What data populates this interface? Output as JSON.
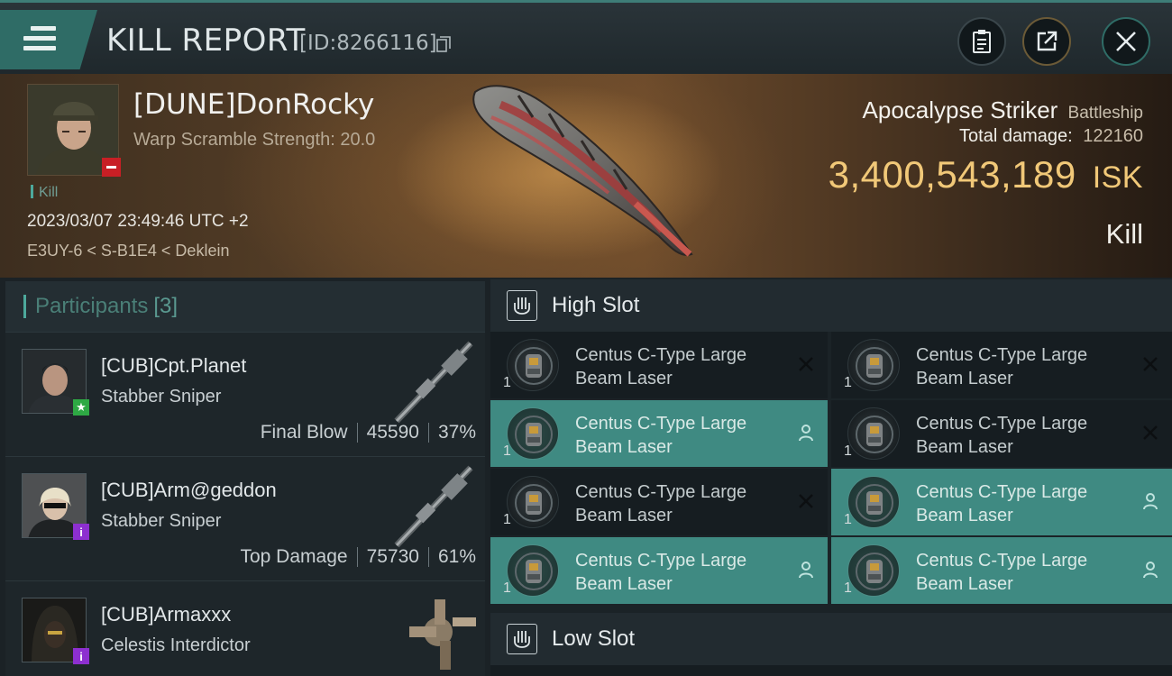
{
  "header": {
    "title": "KILL REPORT",
    "id_text": "[ID:8266116]"
  },
  "victim": {
    "name": "[DUNE]DonRocky",
    "warp_scramble": "Warp Scramble Strength: 20.0",
    "kill_tag": "Kill",
    "timestamp": "2023/03/07 23:49:46 UTC +2",
    "location": "E3UY-6 < S-B1E4 < Deklein"
  },
  "ship": {
    "name": "Apocalypse Striker",
    "class": "Battleship",
    "total_damage_label": "Total damage:",
    "total_damage_value": "122160",
    "isk_value": "3,400,543,189",
    "isk_unit": "ISK",
    "result": "Kill"
  },
  "participants": {
    "label": "Participants",
    "count": "[3]",
    "rows": [
      {
        "name": "[CUB]Cpt.Planet",
        "ship": "Stabber Sniper",
        "role": "Final Blow",
        "damage": "45590",
        "percent": "37%",
        "badge": "star"
      },
      {
        "name": "[CUB]Arm@geddon",
        "ship": "Stabber Sniper",
        "role": "Top Damage",
        "damage": "75730",
        "percent": "61%",
        "badge": "info"
      },
      {
        "name": "[CUB]Armaxxx",
        "ship": "Celestis Interdictor",
        "role": "",
        "damage": "",
        "percent": "",
        "badge": "info"
      }
    ]
  },
  "fitting": {
    "high_slot_label": "High Slot",
    "low_slot_label": "Low Slot",
    "high_slots": [
      {
        "name": "Centus C-Type Large Beam Laser",
        "qty": "1",
        "status": "destroyed"
      },
      {
        "name": "Centus C-Type Large Beam Laser",
        "qty": "1",
        "status": "destroyed"
      },
      {
        "name": "Centus C-Type Large Beam Laser",
        "qty": "1",
        "status": "dropped"
      },
      {
        "name": "Centus C-Type Large Beam Laser",
        "qty": "1",
        "status": "destroyed"
      },
      {
        "name": "Centus C-Type Large Beam Laser",
        "qty": "1",
        "status": "destroyed"
      },
      {
        "name": "Centus C-Type Large Beam Laser",
        "qty": "1",
        "status": "dropped"
      },
      {
        "name": "Centus C-Type Large Beam Laser",
        "qty": "1",
        "status": "dropped"
      },
      {
        "name": "Centus C-Type Large Beam Laser",
        "qty": "1",
        "status": "dropped"
      }
    ]
  },
  "colors": {
    "accent": "#3f8a82",
    "isk_gold": "#f1c878",
    "loss_red": "#c81f25",
    "badge_green": "#2ea944",
    "badge_purple": "#8d2fd0"
  },
  "icons": {
    "menu": "hamburger-icon",
    "copy": "copy-icon",
    "report": "clipboard-icon",
    "share": "share-icon",
    "close": "close-icon",
    "dropped": "person-icon",
    "destroyed": "x-icon",
    "slot": "high-slot-icon"
  }
}
